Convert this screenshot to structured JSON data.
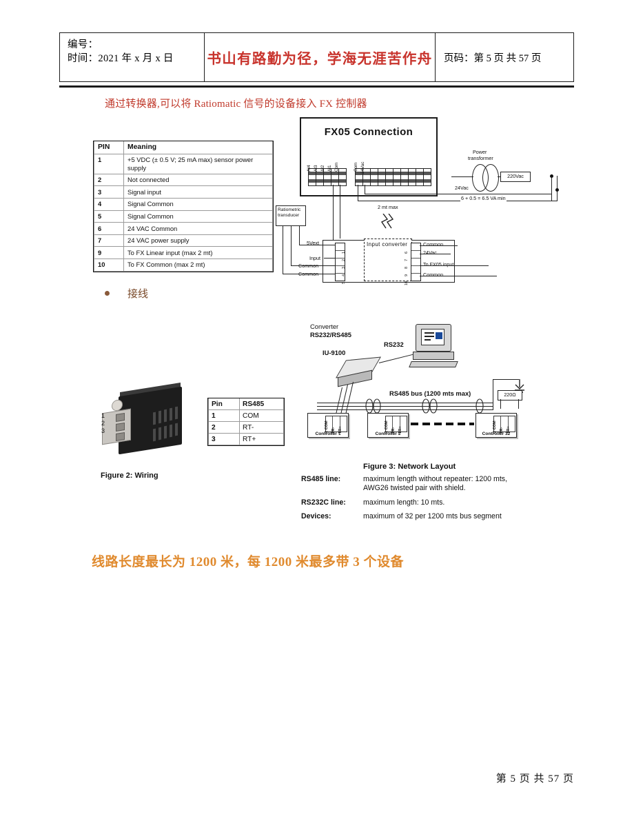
{
  "header": {
    "label_number": "编号：",
    "label_time": "时间：2021 年 x 月 x 日",
    "motto": "书山有路勤为径，学海无涯苦作舟",
    "page_info": "页码：第 5 页  共 57 页"
  },
  "intro": "通过转换器,可以将 Ratiomatic 信号的设备接入 FX 控制器",
  "pin_table": {
    "headers": [
      "PIN",
      "Meaning"
    ],
    "rows": [
      {
        "pin": "1",
        "meaning": "+5 VDC (± 0.5 V; 25 mA max) sensor power supply"
      },
      {
        "pin": "2",
        "meaning": "Not connected"
      },
      {
        "pin": "3",
        "meaning": "Signal input"
      },
      {
        "pin": "4",
        "meaning": "Signal Common"
      },
      {
        "pin": "5",
        "meaning": "Signal Common"
      },
      {
        "pin": "6",
        "meaning": "24 VAC Common"
      },
      {
        "pin": "7",
        "meaning": "24 VAC power supply"
      },
      {
        "pin": "9",
        "meaning": "To FX Linear input (max 2 mt)"
      },
      {
        "pin": "10",
        "meaning": "To FX Common (max 2 mt)"
      }
    ]
  },
  "fx_diagram": {
    "title": "FX05 Connection",
    "analog_terminals": [
      "AI4",
      "AI3",
      "AI2",
      "AI1",
      "Com"
    ],
    "power_terminals": [
      "Com",
      "24Vac"
    ],
    "transformer_label": "Power\ntransformer",
    "transformer_line1": "Power",
    "transformer_line2": "transformer",
    "mains_voltage": "220Vac",
    "secondary_voltage": "24Vac",
    "va_rating": "6 + 0.5 = 6.5 VA min",
    "distance_note": "2 mt max",
    "transducer_line1": "Ratiometric",
    "transducer_line2": "transducer",
    "converter_label": "Input converter",
    "left_labels": [
      "5Vext",
      "Input",
      "Common",
      "Common"
    ],
    "left_pin_numbers": [
      "1",
      "2",
      "3",
      "4",
      "5"
    ],
    "right_labels": [
      "Common",
      "24Vac",
      "To FX05 input",
      "Common"
    ],
    "right_pin_numbers": [
      "6",
      "7",
      "8",
      "9",
      "10"
    ]
  },
  "bullet": {
    "text": "接线"
  },
  "figure2": {
    "caption": "Figure 2: Wiring",
    "terminal_numbers": [
      "1",
      "2",
      "3"
    ]
  },
  "rs_table": {
    "headers": [
      "Pin",
      "RS485"
    ],
    "rows": [
      {
        "pin": "1",
        "signal": "COM"
      },
      {
        "pin": "2",
        "signal": "RT-"
      },
      {
        "pin": "3",
        "signal": "RT+"
      }
    ]
  },
  "network": {
    "converter_line1": "Converter",
    "converter_line2": "RS232/RS485",
    "converter_model": "IU-9100",
    "rs232_label": "RS232",
    "bus_label": "RS485 bus (1200 mts max)",
    "terminator": "220Ω",
    "controllers": [
      {
        "name": "Controller 1",
        "terminals": [
          "C COM",
          "TR-",
          "TR+"
        ]
      },
      {
        "name": "Controller 2",
        "terminals": [
          "C COM",
          "TR-",
          "TR+"
        ]
      },
      {
        "name": "Controller 32",
        "terminals": [
          "C COM",
          "TR-",
          "TR+"
        ]
      }
    ]
  },
  "figure3": {
    "title": "Figure 3: Network Layout",
    "rows": [
      {
        "key": "RS485 line:",
        "value": "maximum length without repeater: 1200 mts, AWG26 twisted pair with shield."
      },
      {
        "key": "RS232C line:",
        "value": "maximum length: 10 mts."
      },
      {
        "key": "Devices:",
        "value": "maximum of 32 per 1200 mts bus segment"
      }
    ]
  },
  "orange_note": "线路长度最长为 1200 米，每 1200 米最多带 3 个设备",
  "footer": {
    "page": "第 5 页  共 57 页"
  },
  "colors": {
    "motto": "#c8332c",
    "intro": "#c0392b",
    "orange": "#e08a2e",
    "bullet": "#7a4a2a"
  }
}
